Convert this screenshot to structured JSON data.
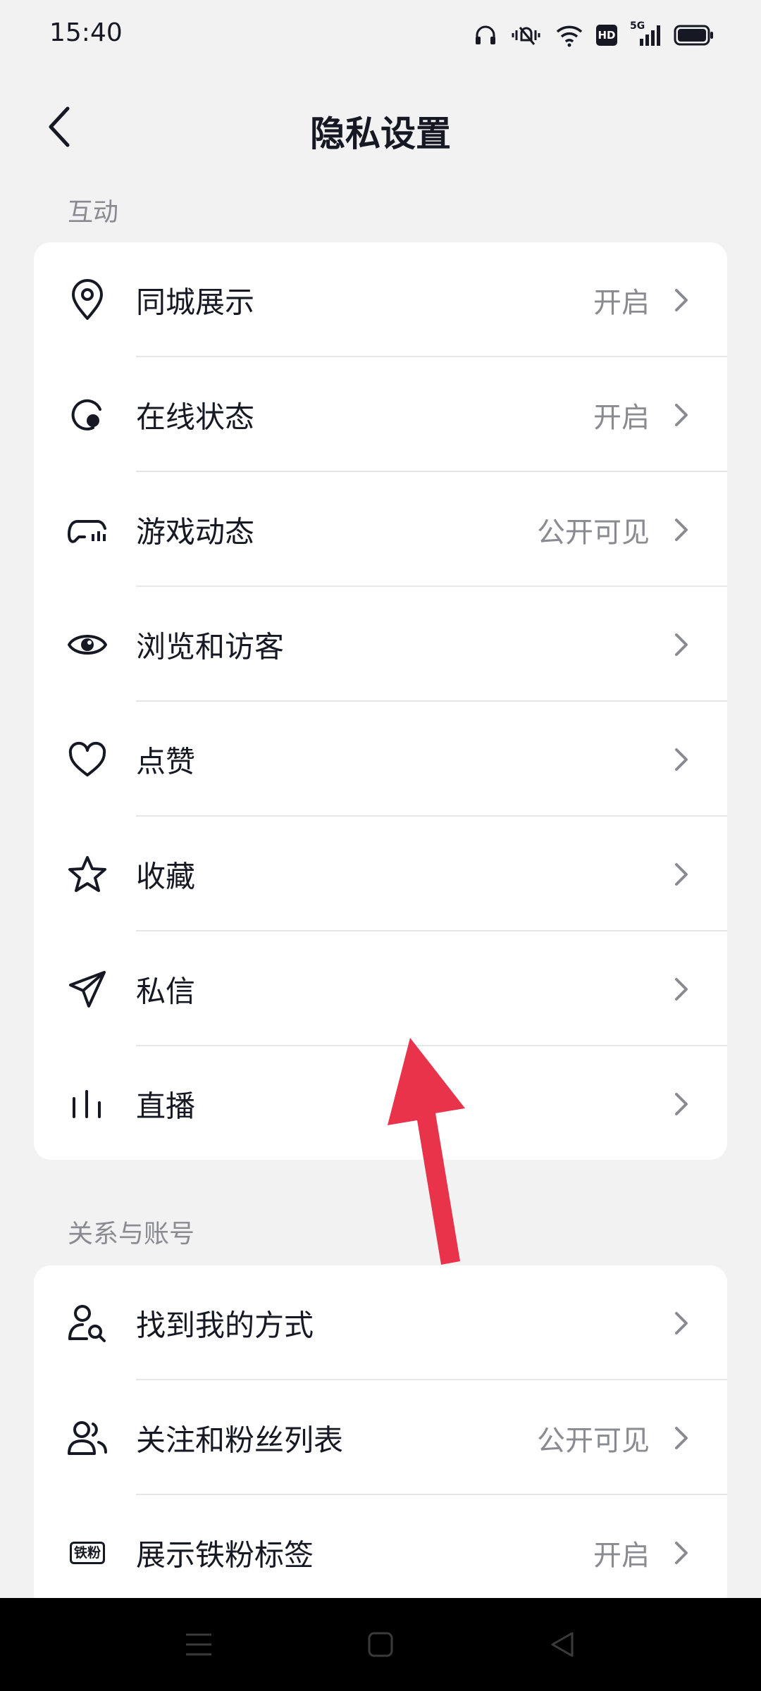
{
  "status_bar": {
    "time": "15:40",
    "icons": [
      "headphones-icon",
      "mute-icon",
      "wifi-icon",
      "hd-badge",
      "signal-5g-icon",
      "battery-icon"
    ],
    "hd_label": "HD",
    "network_label": "5G"
  },
  "header": {
    "title": "隐私设置",
    "back_icon": "chevron-left-icon"
  },
  "sections": [
    {
      "title": "互动",
      "items": [
        {
          "icon": "location-pin-icon",
          "label": "同城展示",
          "value": "开启"
        },
        {
          "icon": "online-status-icon",
          "label": "在线状态",
          "value": "开启"
        },
        {
          "icon": "gamepad-icon",
          "label": "游戏动态",
          "value": "公开可见"
        },
        {
          "icon": "eye-icon",
          "label": "浏览和访客",
          "value": ""
        },
        {
          "icon": "heart-icon",
          "label": "点赞",
          "value": ""
        },
        {
          "icon": "star-icon",
          "label": "收藏",
          "value": ""
        },
        {
          "icon": "paper-plane-icon",
          "label": "私信",
          "value": ""
        },
        {
          "icon": "live-bars-icon",
          "label": "直播",
          "value": ""
        }
      ]
    },
    {
      "title": "关系与账号",
      "items": [
        {
          "icon": "find-user-icon",
          "label": "找到我的方式",
          "value": ""
        },
        {
          "icon": "users-icon",
          "label": "关注和粉丝列表",
          "value": "公开可见"
        },
        {
          "icon": "fan-badge-icon",
          "label": "展示铁粉标签",
          "value": "开启",
          "badge_text": "铁粉"
        }
      ]
    }
  ],
  "annotation": {
    "icon": "red-arrow-icon",
    "color": "#e8334a"
  },
  "system_nav": {
    "icons": [
      "menu-lines-icon",
      "home-square-icon",
      "back-triangle-icon"
    ]
  },
  "colors": {
    "background": "#f2f2f2",
    "card": "#ffffff",
    "text": "#161823",
    "secondary": "#8a8b91"
  }
}
